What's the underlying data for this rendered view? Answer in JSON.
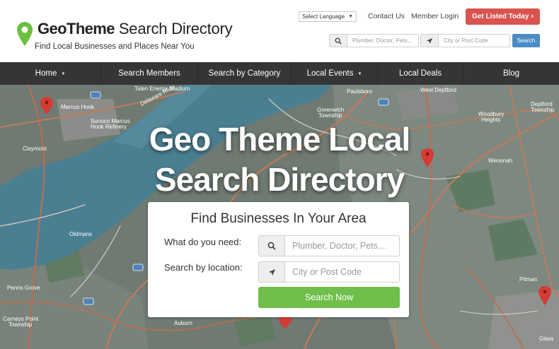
{
  "brand": {
    "name_bold": "GeoTheme",
    "name_rest": " Search Directory",
    "tagline": "Find Local Businesses and Places Near You"
  },
  "topbar": {
    "language_select": "Select Language",
    "contact": "Contact Us",
    "login": "Member Login",
    "cta": "Get Listed Today"
  },
  "header_search": {
    "what_placeholder": "Plumber, Doctor, Pets...",
    "where_placeholder": "City or Post Code",
    "button": "Search"
  },
  "nav": {
    "items": [
      {
        "label": "Home",
        "dropdown": true
      },
      {
        "label": "Search Members",
        "dropdown": false
      },
      {
        "label": "Search by Category",
        "dropdown": false
      },
      {
        "label": "Local Events",
        "dropdown": true
      },
      {
        "label": "Local Deals",
        "dropdown": false
      },
      {
        "label": "Blog",
        "dropdown": false
      }
    ]
  },
  "hero": {
    "title_line1": "Geo Theme Local",
    "title_line2": "Search Directory"
  },
  "search_card": {
    "title": "Find Businesses In Your Area",
    "what_label": "What do you need:",
    "what_placeholder": "Plumber, Doctor, Pets...",
    "where_label": "Search by location:",
    "where_placeholder": "City or Post Code",
    "button": "Search Now"
  },
  "map_labels": {
    "marcus_hook": "Marcus Hook",
    "sunoco": "Sunoco Marcus",
    "sunoco2": "Hook Refinery",
    "claymont": "Claymont",
    "paulsboro": "Paulsboro",
    "west_deptford": "West Deptford",
    "greenwich": "Greenwich",
    "greenwich2": "Township",
    "woodbury": "Woodbury",
    "woodbury2": "Heights",
    "deptford": "Deptford",
    "deptford2": "Township",
    "wenonah": "Wenonah",
    "oldmans": "Oldmans",
    "penns_grove": "Penns Grove",
    "carneys_point": "Carneys Point",
    "carneys_point2": "Township",
    "pitman": "Pitman",
    "auburn": "Auburn",
    "glassboro": "Glass",
    "stadium": "Talen Energy Stadium",
    "delaware_river": "Delaware River"
  },
  "colors": {
    "cta": "#d9534f",
    "search_button": "#4b8cc5",
    "search_now": "#6fbf4a",
    "nav_bg": "#353535",
    "pin_green": "#6cbf3f",
    "map_pin": "#d63a34"
  },
  "icons": {
    "logo": "map-pin-icon",
    "search": "search-icon",
    "location": "location-arrow-icon",
    "cta_arrow": "chevron-right-icon"
  }
}
